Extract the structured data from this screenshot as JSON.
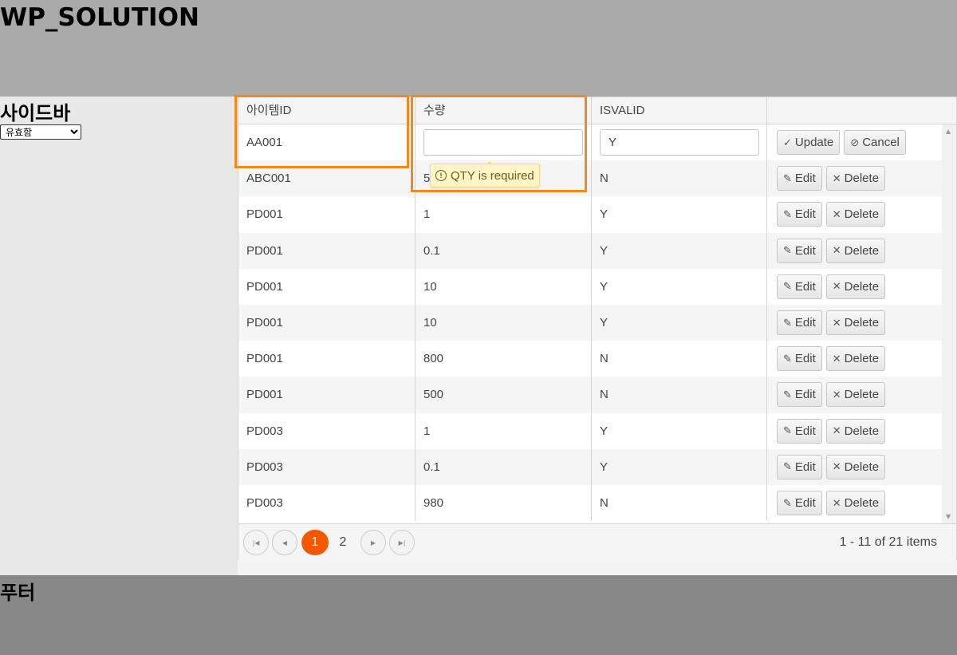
{
  "header": {
    "title": "WP_SOLUTION"
  },
  "sidebar": {
    "title": "사이드바",
    "filter_selected": "유효함"
  },
  "grid": {
    "columns": [
      "아이템ID",
      "수량",
      "ISVALID",
      ""
    ],
    "edit_row": {
      "item_id": "AA001",
      "qty": "",
      "isvalid": "Y",
      "update_label": "Update",
      "cancel_label": "Cancel"
    },
    "tooltip": "QTY is required",
    "rows": [
      {
        "item_id": "ABC001",
        "qty": "5",
        "isvalid": "N"
      },
      {
        "item_id": "PD001",
        "qty": "1",
        "isvalid": "Y"
      },
      {
        "item_id": "PD001",
        "qty": "0.1",
        "isvalid": "Y"
      },
      {
        "item_id": "PD001",
        "qty": "10",
        "isvalid": "Y"
      },
      {
        "item_id": "PD001",
        "qty": "10",
        "isvalid": "Y"
      },
      {
        "item_id": "PD001",
        "qty": "800",
        "isvalid": "N"
      },
      {
        "item_id": "PD001",
        "qty": "500",
        "isvalid": "N"
      },
      {
        "item_id": "PD003",
        "qty": "1",
        "isvalid": "Y"
      },
      {
        "item_id": "PD003",
        "qty": "0.1",
        "isvalid": "Y"
      },
      {
        "item_id": "PD003",
        "qty": "980",
        "isvalid": "N"
      }
    ],
    "edit_label": "Edit",
    "delete_label": "Delete"
  },
  "pager": {
    "pages": [
      "1",
      "2"
    ],
    "current": "1",
    "info": "1 - 11 of 21 items"
  },
  "footer": {
    "title": "푸터"
  },
  "colors": {
    "header_bg": "#aaaaaa",
    "footer_bg": "#888888",
    "sidebar_bg": "#e8e8e8",
    "accent": "#f35800",
    "highlight": "#f18a1c"
  }
}
